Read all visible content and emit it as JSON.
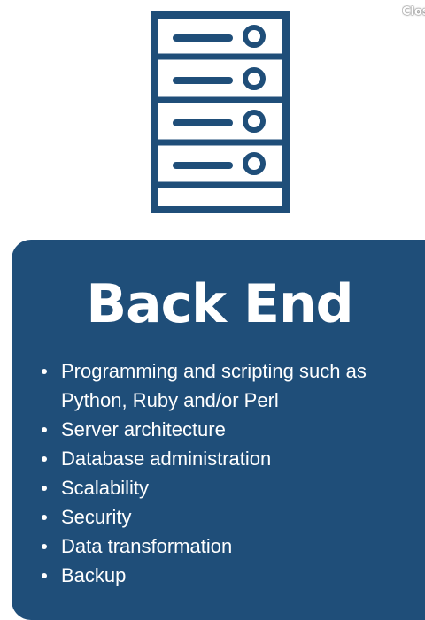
{
  "close_label": "Close",
  "icon": "server-rack-icon",
  "colors": {
    "primary": "#1f4e79",
    "text_on_primary": "#ffffff",
    "background": "#ffffff"
  },
  "card": {
    "title": "Back End",
    "items": [
      "Programming and scripting such as Python, Ruby and/or Perl",
      "Server architecture",
      "Database administration",
      "Scalability",
      "Security",
      "Data transformation",
      "Backup"
    ]
  }
}
